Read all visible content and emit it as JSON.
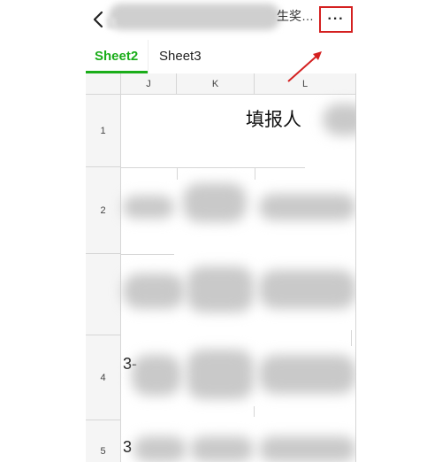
{
  "header": {
    "title_suffix": "生奖…",
    "more_label": "···"
  },
  "tabs": [
    {
      "label": "Sheet2",
      "active": true
    },
    {
      "label": "Sheet3",
      "active": false
    }
  ],
  "columns": [
    "J",
    "K",
    "L"
  ],
  "rows": [
    "1",
    "2",
    "",
    "4",
    "5"
  ],
  "cells": {
    "filler_label": "填报人"
  },
  "colors": {
    "accent": "#1aad19",
    "highlight": "#d42020"
  }
}
